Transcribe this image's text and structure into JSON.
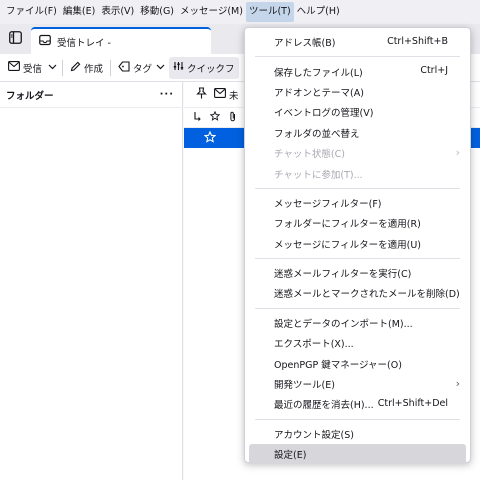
{
  "menubar": {
    "items": [
      "ファイル(F)",
      "編集(E)",
      "表示(V)",
      "移動(G)",
      "メッセージ(M)",
      "ツール(T)",
      "ヘルプ(H)"
    ],
    "active_index": 5
  },
  "tabs": [
    {
      "label": "受信トレイ -"
    }
  ],
  "toolbar": {
    "get_messages": "受信",
    "write": "作成",
    "tag": "タグ",
    "quick_filter": "クイックフ"
  },
  "folder_pane": {
    "title": "フォルダー",
    "menu_glyph": "···"
  },
  "thread_pane": {
    "toolbar_partial": "未"
  },
  "tools_menu": {
    "sections": [
      [
        {
          "label": "アドレス帳(B)",
          "shortcut": "Ctrl+Shift+B"
        }
      ],
      [
        {
          "label": "保存したファイル(L)",
          "shortcut": "Ctrl+J"
        },
        {
          "label": "アドオンとテーマ(A)"
        },
        {
          "label": "イベントログの管理(V)"
        },
        {
          "label": "フォルダの並べ替え"
        },
        {
          "label": "チャット状態(C)",
          "disabled": true,
          "submenu": true
        },
        {
          "label": "チャットに参加(T)...",
          "disabled": true
        }
      ],
      [
        {
          "label": "メッセージフィルター(F)"
        },
        {
          "label": "フォルダーにフィルターを適用(R)"
        },
        {
          "label": "メッセージにフィルターを適用(U)"
        }
      ],
      [
        {
          "label": "迷惑メールフィルターを実行(C)"
        },
        {
          "label": "迷惑メールとマークされたメールを削除(D)"
        }
      ],
      [
        {
          "label": "設定とデータのインポート(M)..."
        },
        {
          "label": "エクスポート(X)..."
        },
        {
          "label": "OpenPGP 鍵マネージャー(O)"
        },
        {
          "label": "開発ツール(E)",
          "submenu": true
        },
        {
          "label": "最近の履歴を消去(H)...",
          "shortcut": "Ctrl+Shift+Del"
        }
      ],
      [
        {
          "label": "アカウント設定(S)"
        },
        {
          "label": "設定(E)",
          "hover": true
        }
      ]
    ]
  }
}
